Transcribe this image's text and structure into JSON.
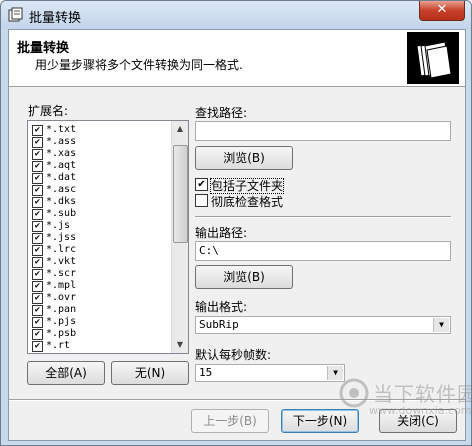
{
  "window": {
    "title": "批量转换",
    "close_label": "✕"
  },
  "header": {
    "title": "批量转换",
    "subtitle": "用少量步骤将多个文件转换为同一格式."
  },
  "ext_panel": {
    "label": "扩展名:",
    "items": [
      {
        "label": "*.txt",
        "checked": true
      },
      {
        "label": "*.ass",
        "checked": true
      },
      {
        "label": "*.xas",
        "checked": true
      },
      {
        "label": "*.aqt",
        "checked": true
      },
      {
        "label": "*.dat",
        "checked": true
      },
      {
        "label": "*.asc",
        "checked": true
      },
      {
        "label": "*.dks",
        "checked": true
      },
      {
        "label": "*.sub",
        "checked": true
      },
      {
        "label": "*.js",
        "checked": true
      },
      {
        "label": "*.jss",
        "checked": true
      },
      {
        "label": "*.lrc",
        "checked": true
      },
      {
        "label": "*.vkt",
        "checked": true
      },
      {
        "label": "*.scr",
        "checked": true
      },
      {
        "label": "*.mpl",
        "checked": true
      },
      {
        "label": "*.ovr",
        "checked": true
      },
      {
        "label": "*.pan",
        "checked": true
      },
      {
        "label": "*.pjs",
        "checked": true
      },
      {
        "label": "*.psb",
        "checked": true
      },
      {
        "label": "*.rt",
        "checked": true
      }
    ],
    "all_button": "全部(A)",
    "none_button": "无(N)"
  },
  "search": {
    "label": "查找路径:",
    "value": "",
    "browse_button": "浏览(B)"
  },
  "options": {
    "include_subfolders": {
      "label": "包括子文件夹",
      "checked": true
    },
    "thorough_check": {
      "label": "彻底检查格式",
      "checked": false
    }
  },
  "output": {
    "label": "输出路径:",
    "value": "C:\\",
    "browse_button": "浏览(B)"
  },
  "format": {
    "label": "输出格式:",
    "selected": "SubRip"
  },
  "fps": {
    "label": "默认每秒帧数:",
    "selected": "15"
  },
  "footer": {
    "back_button": "上一步(B)",
    "next_button": "下一步(N)",
    "close_button": "关闭(C)"
  },
  "watermark": {
    "text": "当下软件园",
    "url": "www.downxia.com"
  }
}
